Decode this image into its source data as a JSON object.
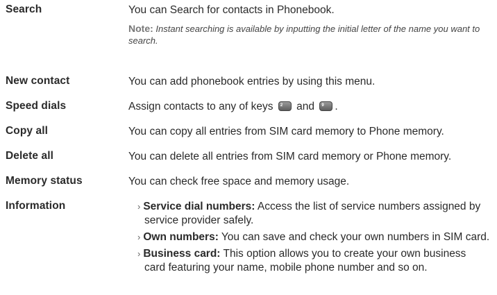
{
  "rows": {
    "search": {
      "term": "Search",
      "desc": "You can Search for contacts in Phonebook.",
      "note_label": "Note:",
      "note_text": "Instant searching is available by inputting the initial letter of the name you want to search."
    },
    "new_contact": {
      "term": "New contact",
      "desc": "You can add phonebook entries by using this menu."
    },
    "speed_dials": {
      "term": "Speed dials",
      "desc_before": "Assign contacts to any of keys",
      "desc_and": "and",
      "desc_end": ".",
      "key_start_label": "2",
      "key_end_label": "9"
    },
    "copy_all": {
      "term": "Copy all",
      "desc": "You can copy all entries from SIM card memory to Phone memory."
    },
    "delete_all": {
      "term": "Delete all",
      "desc": "You can delete all entries from SIM card memory or Phone memory."
    },
    "memory_status": {
      "term": "Memory status",
      "desc": "You can check free space and memory usage."
    },
    "information": {
      "term": "Information",
      "bullet_marker": "›",
      "items": [
        {
          "title": "Service dial numbers:",
          "text": "Access the list of service numbers assigned by",
          "cont": "service provider safely."
        },
        {
          "title": "Own numbers:",
          "text": "You can save and check your own numbers in SIM card."
        },
        {
          "title": "Business card:",
          "text": "This option allows you to create your own business",
          "cont": "card featuring your name, mobile phone number and so on."
        }
      ]
    }
  }
}
